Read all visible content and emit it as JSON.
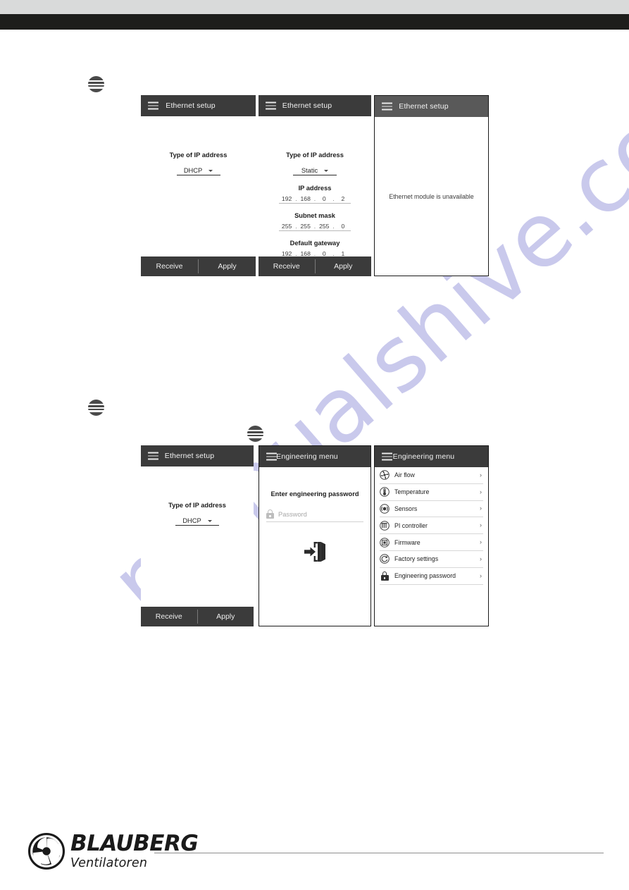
{
  "document": {
    "brand": "BLAUBERG",
    "brand_sub": "Ventilatoren",
    "watermark": "manualshive.com"
  },
  "step_markers": [
    {
      "name": "step-marker-1"
    },
    {
      "name": "step-marker-2"
    },
    {
      "name": "step-marker-3"
    }
  ],
  "row1": {
    "screen_dhcp": {
      "title": "Ethernet setup",
      "menu_icon": "hamburger-icon",
      "type_label": "Type of IP address",
      "type_value": "DHCP",
      "footer": {
        "receive": "Receive",
        "apply": "Apply"
      }
    },
    "screen_static": {
      "title": "Ethernet setup",
      "menu_icon": "hamburger-icon",
      "type_label": "Type of IP address",
      "type_value": "Static",
      "fields": [
        {
          "label": "IP address",
          "octets": [
            "192",
            "168",
            "0",
            "2"
          ]
        },
        {
          "label": "Subnet mask",
          "octets": [
            "255",
            "255",
            "255",
            "0"
          ]
        },
        {
          "label": "Default gateway",
          "octets": [
            "192",
            "168",
            "0",
            "1"
          ]
        }
      ],
      "footer": {
        "receive": "Receive",
        "apply": "Apply"
      }
    },
    "screen_unavailable": {
      "title": "Ethernet setup",
      "menu_icon": "hamburger-icon",
      "message": "Ethernet module is unavailable"
    }
  },
  "row2": {
    "screen_dhcp": {
      "title": "Ethernet setup",
      "menu_icon": "hamburger-icon",
      "type_label": "Type of IP address",
      "type_value": "DHCP",
      "footer": {
        "receive": "Receive",
        "apply": "Apply"
      }
    },
    "screen_password": {
      "title": "Engineering menu",
      "menu_icon": "hamburger-icon",
      "prompt": "Enter engineering password",
      "password_placeholder": "Password",
      "password_value": "",
      "lock_icon": "lock-icon",
      "enter_icon": "door-enter-icon"
    },
    "screen_menu": {
      "title": "Engineering menu",
      "menu_icon": "hamburger-icon",
      "items": [
        {
          "label": "Air flow",
          "icon": "fan-icon"
        },
        {
          "label": "Temperature",
          "icon": "thermometer-icon"
        },
        {
          "label": "Sensors",
          "icon": "sensor-icon"
        },
        {
          "label": "PI controller",
          "icon": "pi-controller-icon"
        },
        {
          "label": "Firmware",
          "icon": "chip-icon"
        },
        {
          "label": "Factory settings",
          "icon": "reset-icon"
        },
        {
          "label": "Engineering password",
          "icon": "lock-icon"
        }
      ],
      "chevron": "›"
    }
  },
  "colors": {
    "header_dark": "#3b3b3b",
    "header_light": "#595959",
    "band_light": "#d9dada",
    "band_dark": "#1d1d1b",
    "watermark": "#c9c9ec"
  }
}
